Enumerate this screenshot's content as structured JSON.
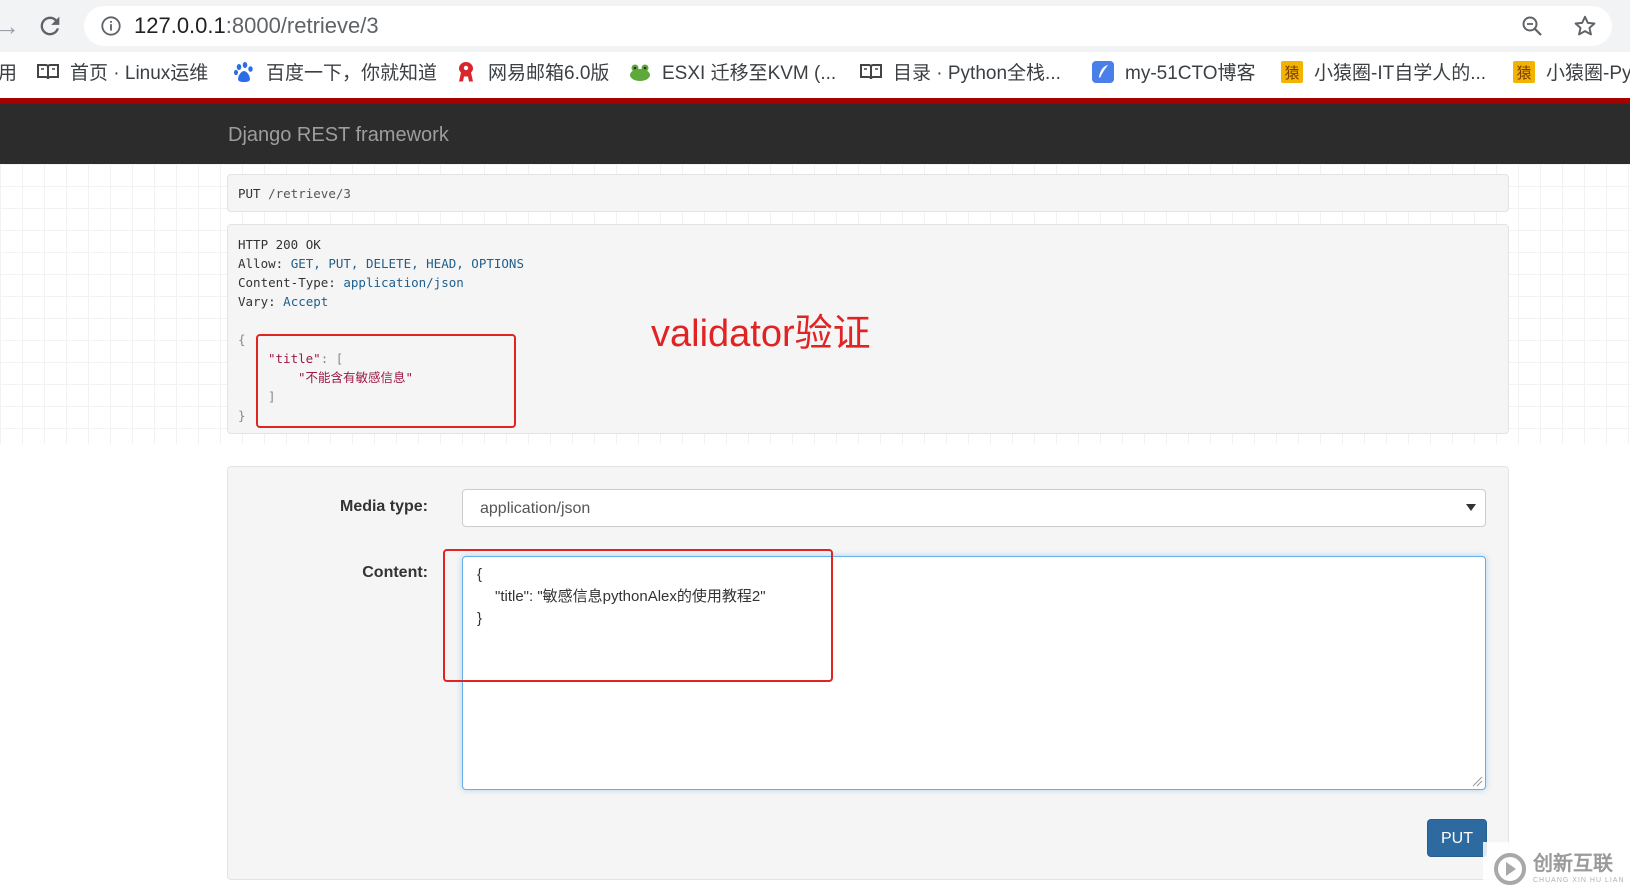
{
  "browser": {
    "url_host": "127.0.0.1",
    "url_path": ":8000/retrieve/3",
    "bookmarks": [
      {
        "label": "用",
        "icon": "app-icon"
      },
      {
        "label": "首页 · Linux运维",
        "icon": "book-icon"
      },
      {
        "label": "百度一下，你就知道",
        "icon": "baidu-paw-icon"
      },
      {
        "label": "网易邮箱6.0版",
        "icon": "netease-mail-icon"
      },
      {
        "label": "ESXI 迁移至KVM (...",
        "icon": "frog-icon"
      },
      {
        "label": "目录 · Python全栈...",
        "icon": "book-icon"
      },
      {
        "label": "my-51CTO博客",
        "icon": "quill-icon"
      },
      {
        "label": "小猿圈-IT自学人的...",
        "icon": "yuan-icon"
      },
      {
        "label": "小猿圈-Py",
        "icon": "yuan-icon"
      }
    ]
  },
  "navbar": {
    "brand": "Django REST framework"
  },
  "request": {
    "method": "PUT",
    "path": "/retrieve/3"
  },
  "response": {
    "status": "HTTP 200 OK",
    "headers": [
      {
        "name": "Allow:",
        "value": "GET, PUT, DELETE, HEAD, OPTIONS"
      },
      {
        "name": "Content-Type:",
        "value": "application/json"
      },
      {
        "name": "Vary:",
        "value": "Accept"
      }
    ],
    "body": {
      "open_brace": "{",
      "key": "\"title\"",
      "colon_bracket": ": [",
      "message": "\"不能含有敏感信息\"",
      "close_bracket": "]",
      "close_brace": "}"
    }
  },
  "annotation": {
    "text": "validator验证",
    "color": "#e02424"
  },
  "form": {
    "media_type_label": "Media type:",
    "media_type_value": "application/json",
    "content_label": "Content:",
    "content_lines": [
      "{",
      "\"title\": \"敏感信息pythonAlex的使用教程2\"",
      "}"
    ],
    "submit_label": "PUT"
  },
  "watermark": {
    "text": "创新互联",
    "subtext": "CHUANG XIN HU LIAN"
  },
  "colors": {
    "navbar_bg": "#2c2c2c",
    "accent_red": "#a30000",
    "button_blue": "#2c6aa0"
  }
}
